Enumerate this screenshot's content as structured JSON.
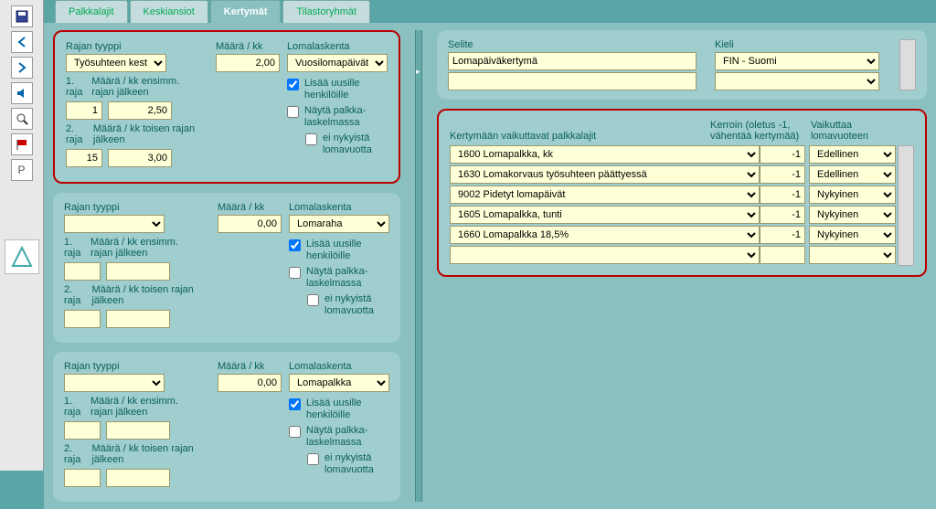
{
  "tabs": [
    "Palkkalajit",
    "Keskiansiot",
    "Kertymät",
    "Tilastoryhmät"
  ],
  "active_tab": "Kertymät",
  "blocks": [
    {
      "highlight": true,
      "rajan_tyyppi_label": "Rajan tyyppi",
      "rajan_tyyppi": "Työsuhteen kesto",
      "maara_kk_label": "Määrä / kk",
      "maara_kk": "2,00",
      "loma_label": "Lomalaskenta",
      "loma": "Vuosilomapäivät",
      "r1_label": "1. raja",
      "r1_desc": "Määrä / kk ensimm. rajan jälkeen",
      "r1_v1": "1",
      "r1_v2": "2,50",
      "r2_label": "2. raja",
      "r2_desc": "Määrä / kk toisen rajan jälkeen",
      "r2_v1": "15",
      "r2_v2": "3,00",
      "chk1": "Lisää uusille henkilöille",
      "chk1_v": true,
      "chk2": "Näytä palkka-\nlaskelmassa",
      "chk2_v": false,
      "chk3": "ei nykyistä lomavuotta",
      "chk3_v": false
    },
    {
      "highlight": false,
      "rajan_tyyppi_label": "Rajan tyyppi",
      "rajan_tyyppi": "",
      "maara_kk_label": "Määrä / kk",
      "maara_kk": "0,00",
      "loma_label": "Lomalaskenta",
      "loma": "Lomaraha",
      "r1_label": "1. raja",
      "r1_desc": "Määrä / kk ensimm. rajan jälkeen",
      "r1_v1": "",
      "r1_v2": "",
      "r2_label": "2. raja",
      "r2_desc": "Määrä / kk toisen rajan jälkeen",
      "r2_v1": "",
      "r2_v2": "",
      "chk1": "Lisää uusille henkilöille",
      "chk1_v": true,
      "chk2": "Näytä palkka-\nlaskelmassa",
      "chk2_v": false,
      "chk3": "ei nykyistä lomavuotta",
      "chk3_v": false
    },
    {
      "highlight": false,
      "rajan_tyyppi_label": "Rajan tyyppi",
      "rajan_tyyppi": "",
      "maara_kk_label": "Määrä / kk",
      "maara_kk": "0,00",
      "loma_label": "Lomalaskenta",
      "loma": "Lomapalkka",
      "r1_label": "1. raja",
      "r1_desc": "Määrä / kk ensimm. rajan jälkeen",
      "r1_v1": "",
      "r1_v2": "",
      "r2_label": "2. raja",
      "r2_desc": "Määrä / kk toisen rajan jälkeen",
      "r2_v1": "",
      "r2_v2": "",
      "chk1": "Lisää uusille henkilöille",
      "chk1_v": true,
      "chk2": "Näytä palkka-\nlaskelmassa",
      "chk2_v": false,
      "chk3": "ei nykyistä lomavuotta",
      "chk3_v": false
    }
  ],
  "right_top": {
    "selite_label": "Selite",
    "selite": "Lomapäiväkertymä",
    "kieli_label": "Kieli",
    "kieli": "FIN - Suomi"
  },
  "right_grid": {
    "h1": "Kertymään vaikuttavat palkkalajit",
    "h2a": "Kerroin (oletus -1,",
    "h2b": "vähentää kertymää)",
    "h3a": "Vaikuttaa",
    "h3b": "lomavuoteen",
    "rows": [
      {
        "name": "1600 Lomapalkka, kk",
        "kerroin": "-1",
        "vaik": "Edellinen"
      },
      {
        "name": "1630 Lomakorvaus työsuhteen päättyessä",
        "kerroin": "-1",
        "vaik": "Edellinen"
      },
      {
        "name": "9002 Pidetyt lomapäivät",
        "kerroin": "-1",
        "vaik": "Nykyinen"
      },
      {
        "name": "1605 Lomapalkka, tunti",
        "kerroin": "-1",
        "vaik": "Nykyinen"
      },
      {
        "name": "1660 Lomapalkka 18,5%",
        "kerroin": "-1",
        "vaik": "Nykyinen"
      },
      {
        "name": "",
        "kerroin": "",
        "vaik": ""
      }
    ]
  },
  "side_icons": [
    "save",
    "back",
    "fwd",
    "sound",
    "zoom",
    "flag",
    "P"
  ]
}
